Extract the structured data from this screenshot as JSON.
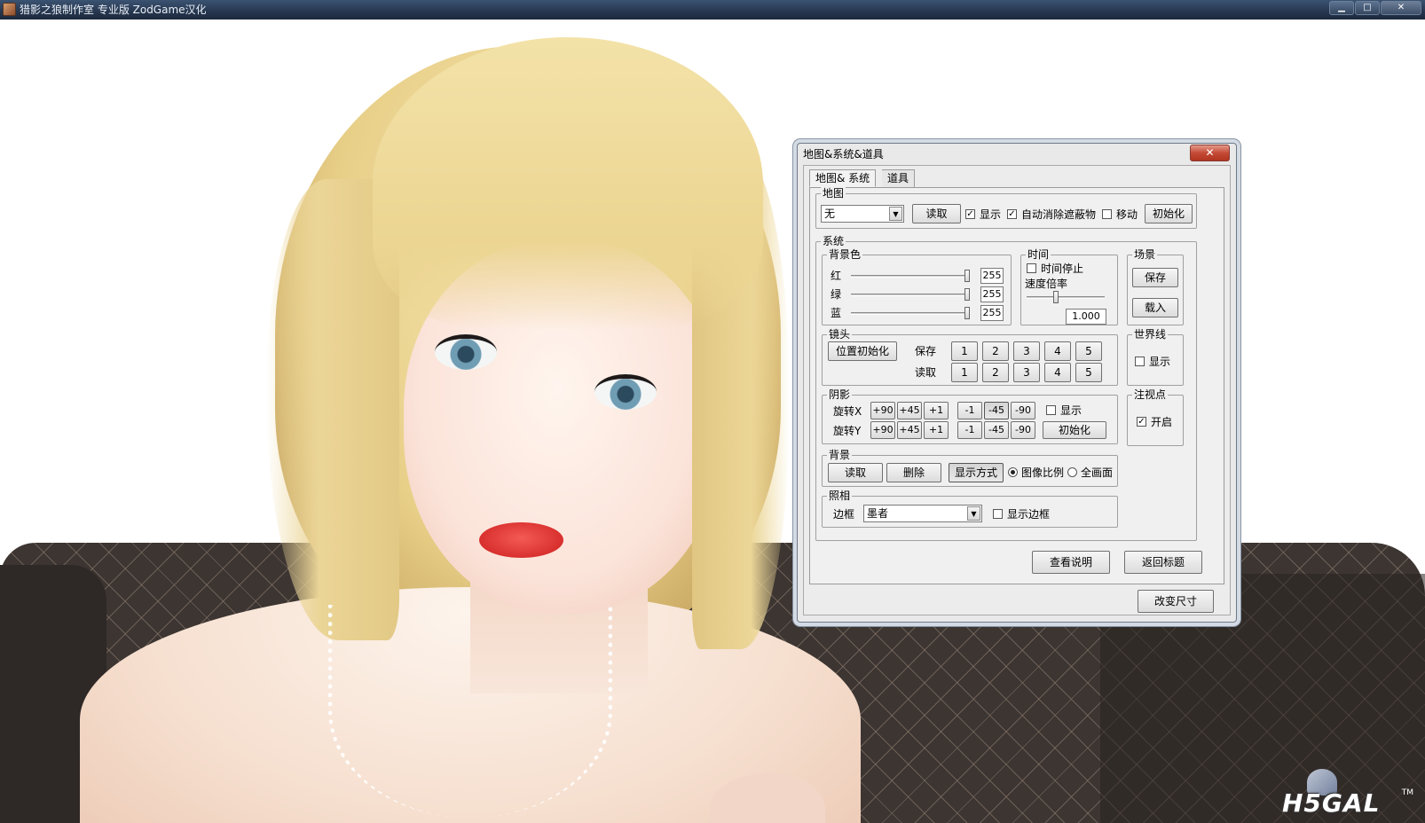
{
  "window": {
    "title": "猎影之狼制作室 专业版 ZodGame汉化",
    "minimize_glyph": "▁",
    "maximize_glyph": "□",
    "close_glyph": "✕"
  },
  "watermark": {
    "text": "H5GAL",
    "tm": "TM"
  },
  "dialog": {
    "title": "地图&系统&道具",
    "close_glyph": "✕",
    "tabs": [
      "地图& 系统",
      "道具"
    ],
    "map": {
      "label": "地图",
      "selected": "无",
      "read": "读取",
      "show": "显示",
      "show_checked": true,
      "auto_remove": "自动消除遮蔽物",
      "auto_remove_checked": true,
      "move": "移动",
      "move_checked": false,
      "init": "初始化"
    },
    "system": {
      "label": "系统",
      "bg_color": {
        "label": "背景色",
        "red": "红",
        "green": "绿",
        "blue": "蓝",
        "red_value": "255",
        "green_value": "255",
        "blue_value": "255",
        "red_level": 1.0,
        "green_level": 1.0,
        "blue_level": 1.0
      },
      "time": {
        "label": "时间",
        "stop": "时间停止",
        "stop_checked": false,
        "speed": "速度倍率",
        "speed_value": "1.000"
      },
      "scene": {
        "label": "场景",
        "save": "保存",
        "load": "载入"
      },
      "camera": {
        "label": "镜头",
        "reset": "位置初始化",
        "save": "保存",
        "read": "读取",
        "slots": [
          "1",
          "2",
          "3",
          "4",
          "5"
        ]
      },
      "worldline": {
        "label": "世界线",
        "show": "显示",
        "checked": false
      },
      "shadow": {
        "label": "阴影",
        "rot_x": "旋转X",
        "rot_y": "旋转Y",
        "steps": [
          "+90",
          "+45",
          "+1",
          "-1",
          "-45",
          "-90"
        ],
        "show": "显示",
        "show_checked": false,
        "init": "初始化"
      },
      "gaze": {
        "label": "注视点",
        "on": "开启",
        "checked": true
      },
      "background": {
        "label": "背景",
        "read": "读取",
        "delete": "删除",
        "display_mode": "显示方式",
        "aspect": "图像比例",
        "fullscreen": "全画面",
        "selected": "aspect"
      },
      "photo": {
        "label": "照相",
        "frame": "边框",
        "frame_selected": "墨者",
        "show_frame": "显示边框",
        "show_frame_checked": false
      }
    },
    "help": "查看说明",
    "back_to_title": "返回标题",
    "resize": "改变尺寸"
  }
}
